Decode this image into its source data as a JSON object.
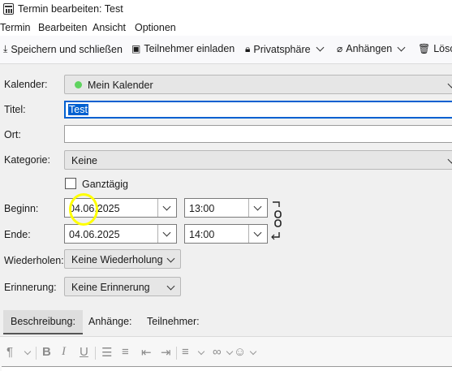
{
  "window": {
    "title": "Termin bearbeiten: Test"
  },
  "menu": [
    "Termin",
    "Bearbeiten",
    "Ansicht",
    "Optionen"
  ],
  "toolbar": {
    "save_close": "Speichern und schließen",
    "invite": "Teilnehmer einladen",
    "privacy": "Privatsphäre",
    "attach": "Anhängen",
    "delete": "Lösch"
  },
  "form": {
    "calendar_label": "Kalender:",
    "calendar_value": "Mein Kalender",
    "calendar_color": "#5fd35f",
    "title_label": "Titel:",
    "title_value": "Test",
    "location_label": "Ort:",
    "location_value": "",
    "category_label": "Kategorie:",
    "category_value": "Keine",
    "allday_label": "Ganztägig",
    "allday_checked": false,
    "start_label": "Beginn:",
    "start_date": "04.06.2025",
    "start_time": "13:00",
    "end_label": "Ende:",
    "end_date": "04.06.2025",
    "end_time": "14:00",
    "repeat_label": "Wiederholen:",
    "repeat_value": "Keine Wiederholung",
    "reminder_label": "Erinnerung:",
    "reminder_value": "Keine Erinnerung"
  },
  "tabs": [
    "Beschreibung:",
    "Anhänge:",
    "Teilnehmer:"
  ],
  "colors": {
    "selection": "#0060d0",
    "highlight": "#ffff00"
  }
}
